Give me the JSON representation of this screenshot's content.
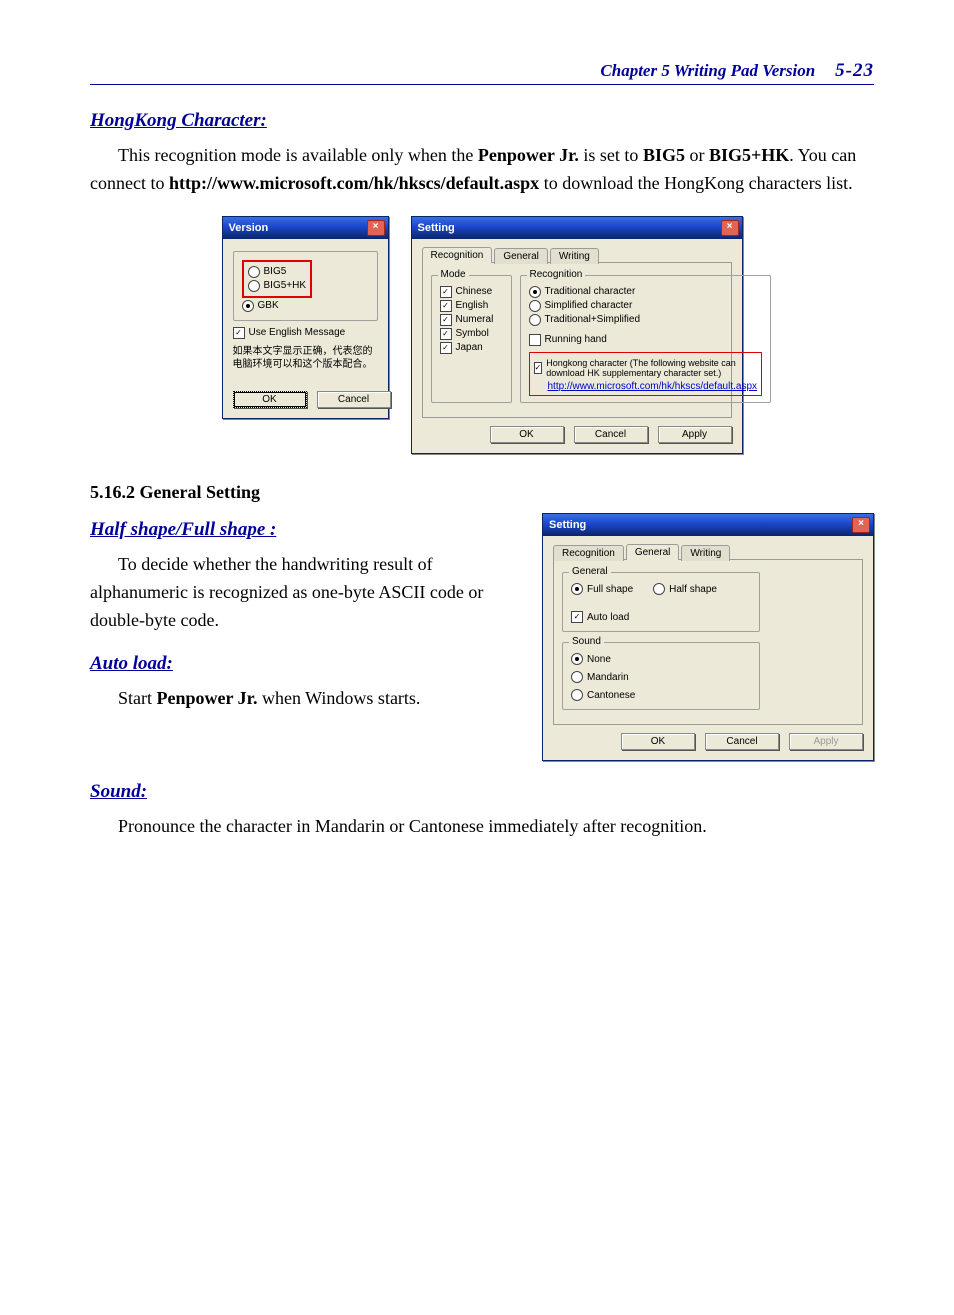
{
  "header": {
    "chapter": "Chapter 5 Writing Pad Version",
    "page": "5-23"
  },
  "sec_hk": {
    "title": "HongKong Character:",
    "para_pre": "This recognition mode is available only when the ",
    "prod": "Penpower Jr.",
    "para_mid": " is set to ",
    "b5": "BIG5",
    "or": " or ",
    "b5hk": "BIG5+HK",
    "para_post1": ". You can connect to ",
    "url": "http://www.microsoft.com/hk/hkscs/default.aspx",
    "para_post2": " to download the HongKong characters list."
  },
  "dlg_version": {
    "title": "Version",
    "opt_big5": "BIG5",
    "opt_big5hk": "BIG5+HK",
    "opt_gbk": "GBK",
    "chk_eng": "Use English Message",
    "cn": "如果本文字显示正确，代表您的电脑环境可以和这个版本配合。",
    "ok": "OK",
    "cancel": "Cancel"
  },
  "dlg_setting1": {
    "title": "Setting",
    "tab_recog": "Recognition",
    "tab_general": "General",
    "tab_writing": "Writing",
    "grp_mode": "Mode",
    "mode_chinese": "Chinese",
    "mode_english": "English",
    "mode_numeral": "Numeral",
    "mode_symbol": "Symbol",
    "mode_japan": "Japan",
    "grp_recog": "Recognition",
    "r_trad": "Traditional character",
    "r_simp": "Simplified character",
    "r_both": "Traditional+Simplified",
    "chk_running": "Running hand",
    "hk_label": "Hongkong character (The following website can download HK supplementary character set.)",
    "hk_url": "http://www.microsoft.com/hk/hkscs/default.aspx",
    "ok": "OK",
    "cancel": "Cancel",
    "apply": "Apply"
  },
  "sec_5162": {
    "title": "5.16.2 General Setting",
    "half_title": "Half shape/Full shape :",
    "half_body": "To decide whether the handwriting result of alphanumeric is recognized as one-byte ASCII code or double-byte code.",
    "auto_title": "Auto load:",
    "auto_pre": "Start ",
    "auto_prod": "Penpower Jr.",
    "auto_post": " when Windows starts."
  },
  "dlg_setting2": {
    "title": "Setting",
    "tab_recog": "Recognition",
    "tab_general": "General",
    "tab_writing": "Writing",
    "grp_general": "General",
    "r_full": "Full shape",
    "r_half": "Half shape",
    "chk_auto": "Auto load",
    "grp_sound": "Sound",
    "s_none": "None",
    "s_mand": "Mandarin",
    "s_cant": "Cantonese",
    "ok": "OK",
    "cancel": "Cancel",
    "apply": "Apply"
  },
  "sec_sound": {
    "title": "Sound:",
    "body": "Pronounce the character in Mandarin or Cantonese immediately after recognition."
  }
}
